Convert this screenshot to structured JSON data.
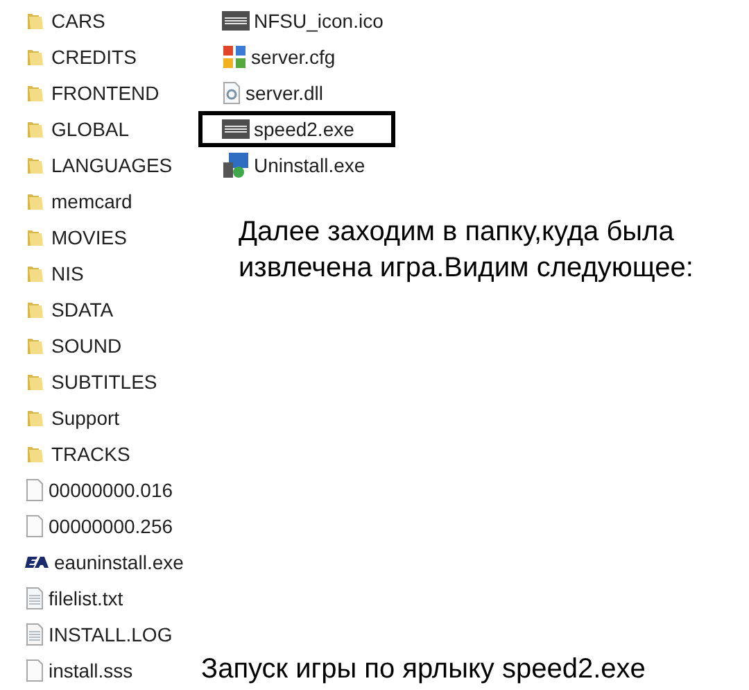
{
  "folder_items": [
    {
      "name": "CARS",
      "kind": "folder"
    },
    {
      "name": "CREDITS",
      "kind": "folder"
    },
    {
      "name": "FRONTEND",
      "kind": "folder"
    },
    {
      "name": "GLOBAL",
      "kind": "folder"
    },
    {
      "name": "LANGUAGES",
      "kind": "folder"
    },
    {
      "name": "memcard",
      "kind": "folder"
    },
    {
      "name": "MOVIES",
      "kind": "folder"
    },
    {
      "name": "NIS",
      "kind": "folder"
    },
    {
      "name": "SDATA",
      "kind": "folder"
    },
    {
      "name": "SOUND",
      "kind": "folder"
    },
    {
      "name": "SUBTITLES",
      "kind": "folder"
    },
    {
      "name": "Support",
      "kind": "folder"
    },
    {
      "name": "TRACKS",
      "kind": "folder"
    },
    {
      "name": "00000000.016",
      "kind": "blank"
    },
    {
      "name": "00000000.256",
      "kind": "blank"
    },
    {
      "name": "eauninstall.exe",
      "kind": "ea"
    },
    {
      "name": "filelist.txt",
      "kind": "text"
    },
    {
      "name": "INSTALL.LOG",
      "kind": "text"
    },
    {
      "name": "install.sss",
      "kind": "blank"
    }
  ],
  "file_items": [
    {
      "name": "NFSU_icon.ico",
      "kind": "nfs",
      "outlined": false
    },
    {
      "name": "server.cfg",
      "kind": "cfg",
      "outlined": false
    },
    {
      "name": "server.dll",
      "kind": "dll",
      "outlined": false
    },
    {
      "name": "speed2.exe",
      "kind": "nfs",
      "outlined": true
    },
    {
      "name": "Uninstall.exe",
      "kind": "installer",
      "outlined": false
    }
  ],
  "caption": "Далее заходим в папку,куда была извлечена игра.Видим следующее:",
  "footer_caption": "Запуск игры по ярлыку speed2.exe"
}
